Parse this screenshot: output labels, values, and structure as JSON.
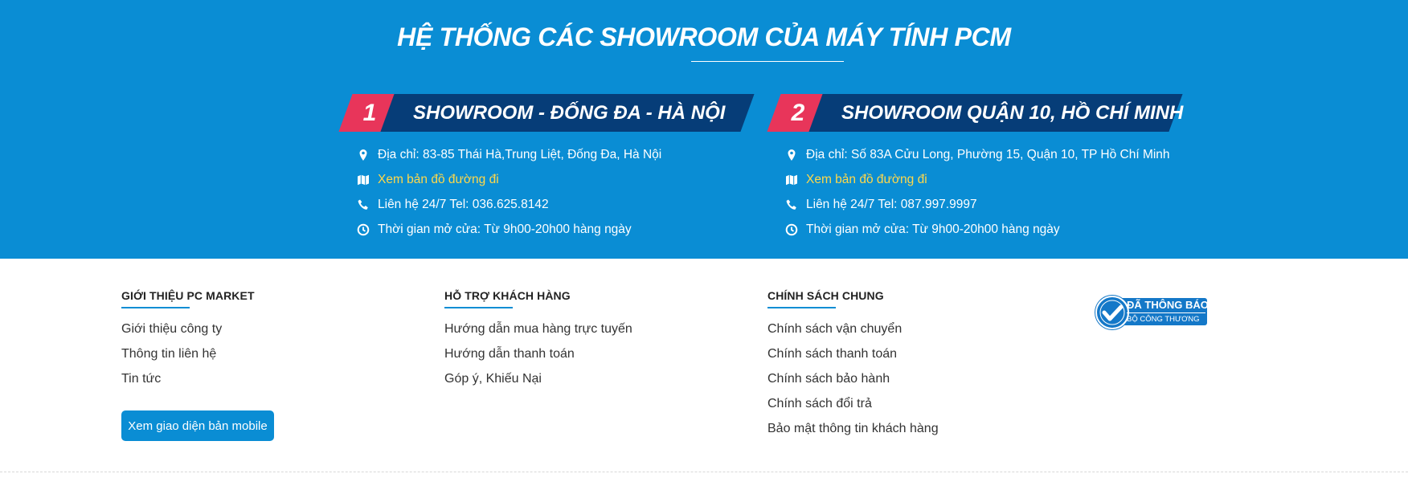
{
  "showrooms_section": {
    "title": "HỆ THỐNG CÁC SHOWROOM CỦA MÁY TÍNH PCM",
    "showrooms": [
      {
        "number": "1",
        "name": "SHOWROOM - ĐỐNG ĐA - HÀ NỘI",
        "address": "Địa chỉ: 83-85 Thái Hà,Trung Liệt, Đống Đa, Hà Nội",
        "map_link": "Xem bản đồ đường đi",
        "phone": "Liên hệ 24/7 Tel: 036.625.8142",
        "hours": "Thời gian mở cửa: Từ 9h00-20h00 hàng ngày"
      },
      {
        "number": "2",
        "name": "SHOWROOM QUẬN 10, HỒ CHÍ MINH",
        "address": "Địa chỉ: Số 83A Cửu Long, Phường 15, Quận 10, TP Hồ Chí Minh",
        "map_link": "Xem bản đồ đường đi",
        "phone": "Liên hệ 24/7 Tel: 087.997.9997",
        "hours": "Thời gian mở cửa: Từ 9h00-20h00 hàng ngày"
      }
    ],
    "icons": [
      "map-marker-icon",
      "map-icon",
      "phone-icon",
      "clock-icon"
    ]
  },
  "footer": {
    "columns": [
      {
        "title": "GIỚI THIỆU PC MARKET",
        "links": [
          "Giới thiệu công ty",
          "Thông tin liên hệ",
          "Tin tức"
        ]
      },
      {
        "title": "HỖ TRỢ KHÁCH HÀNG",
        "links": [
          "Hướng dẫn mua hàng trực tuyến",
          "Hướng dẫn thanh toán",
          "Góp ý, Khiếu Nại"
        ]
      },
      {
        "title": "CHÍNH SÁCH CHUNG",
        "links": [
          "Chính sách vận chuyển",
          "Chính sách thanh toán",
          "Chính sách bảo hành",
          "Chính sách đổi trả",
          "Bảo mật thông tin khách hàng"
        ]
      }
    ],
    "mobile_button": "Xem giao diện bản mobile",
    "badge": {
      "main": "ĐÃ THÔNG BÁO",
      "sub": "BỘ CÔNG THƯƠNG"
    }
  },
  "colors": {
    "band_background": "#0a8dd4",
    "banner_dark": "#063d78",
    "number_accent": "#e8355a",
    "map_link": "#ffd84a",
    "badge_blue": "#1478c8"
  }
}
